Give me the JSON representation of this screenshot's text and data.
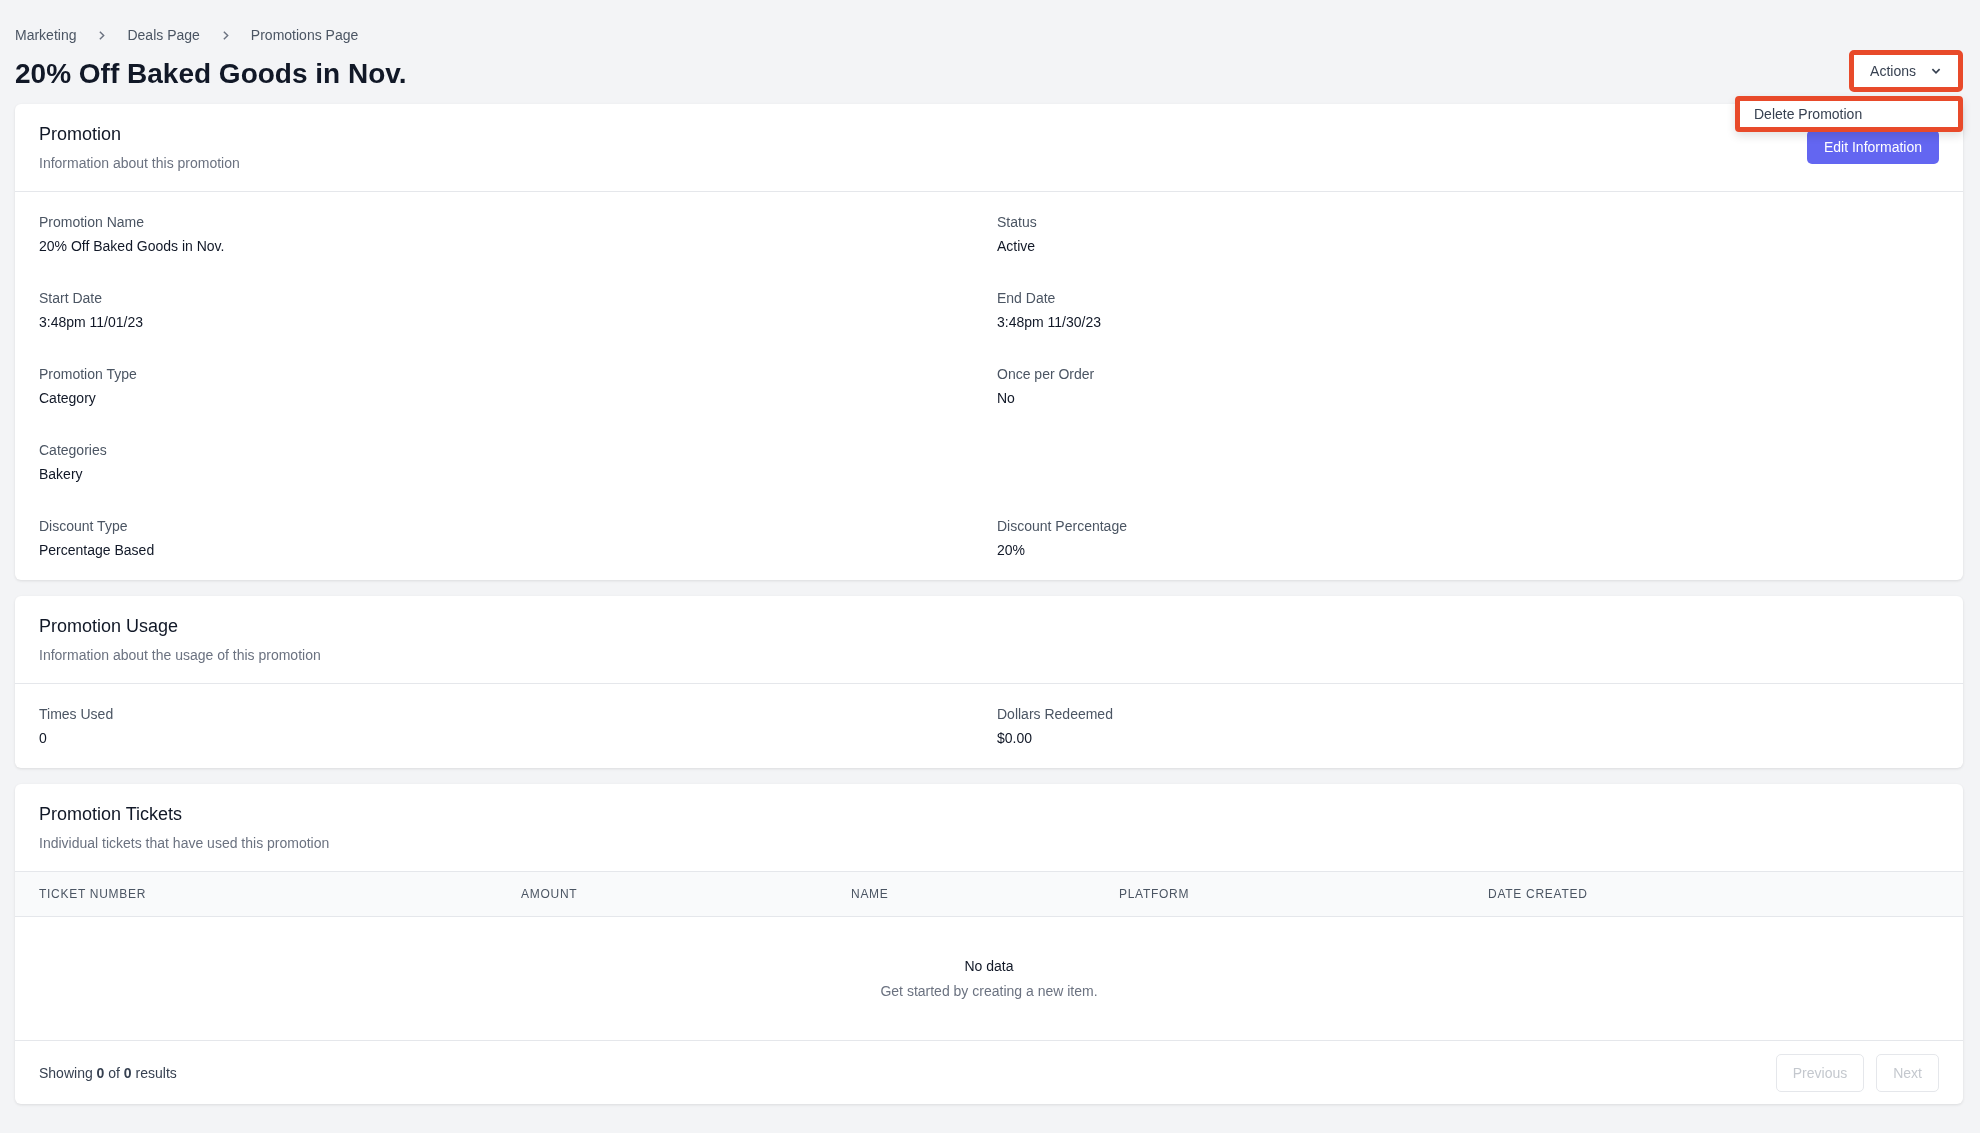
{
  "breadcrumbs": [
    "Marketing",
    "Deals Page",
    "Promotions Page"
  ],
  "title": "20% Off Baked Goods in Nov.",
  "actions": {
    "label": "Actions",
    "expanded": true,
    "highlighted": true,
    "menu": [
      {
        "label": "Delete Promotion",
        "highlighted": true
      }
    ]
  },
  "sections": [
    {
      "kind": "fields",
      "title": "Promotion",
      "subtitle": "Information about this promotion",
      "button": "Edit Information",
      "fields": [
        [
          {
            "label": "Promotion Name",
            "value": "20% Off Baked Goods in Nov."
          },
          {
            "label": "Status",
            "value": "Active"
          }
        ],
        [
          {
            "label": "Start Date",
            "value": "3:48pm 11/01/23"
          },
          {
            "label": "End Date",
            "value": "3:48pm 11/30/23"
          }
        ],
        [
          {
            "label": "Promotion Type",
            "value": "Category"
          },
          {
            "label": "Once per Order",
            "value": "No"
          }
        ],
        [
          {
            "label": "Categories",
            "value": "Bakery"
          }
        ],
        [
          {
            "label": "Discount Type",
            "value": "Percentage Based"
          },
          {
            "label": "Discount Percentage",
            "value": "20%"
          }
        ]
      ]
    },
    {
      "kind": "fields",
      "title": "Promotion Usage",
      "subtitle": "Information about the usage of this promotion",
      "fields": [
        [
          {
            "label": "Times Used",
            "value": "0"
          },
          {
            "label": "Dollars Redeemed",
            "value": "$0.00"
          }
        ]
      ]
    },
    {
      "kind": "table",
      "title": "Promotion Tickets",
      "subtitle": "Individual tickets that have used this promotion",
      "columns": [
        "TICKET NUMBER",
        "AMOUNT",
        "NAME",
        "PLATFORM",
        "DATE CREATED"
      ],
      "empty_title": "No data",
      "empty_text": "Get started by creating a new item.",
      "footer": "Showing **0** of **0** results",
      "pagination": [
        {
          "label": "Previous",
          "disabled": true
        },
        {
          "label": "Next",
          "disabled": true
        }
      ]
    }
  ]
}
